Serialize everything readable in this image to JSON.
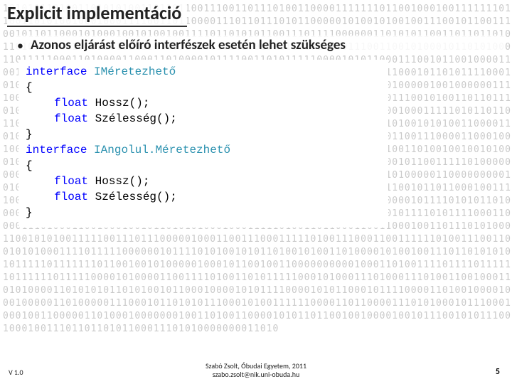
{
  "title": "Explicit implementáció",
  "bullet": "Azonos eljárást előíró interfészek esetén lehet szükséges",
  "code": {
    "l1_kw": "interface",
    "l1_type": "IMéretezhető",
    "l2": "{",
    "l3_kw": "float",
    "l3_rest": " Hossz();",
    "l4_kw": "float",
    "l4_rest": " Szélesség();",
    "l5": "}",
    "l6_kw": "interface",
    "l6_type": "IAngolul.Méretezhető",
    "l7": "{",
    "l8_kw": "float",
    "l8_rest": " Hossz();",
    "l9_kw": "float",
    "l9_rest": " Szélesség();",
    "l10": "}"
  },
  "footer": {
    "version": "V 1.0",
    "line1": "Szabó Zsolt, Óbudai Egyetem, 2011",
    "line2": "szabo.zsolt@nik.uni-obuda.hu",
    "page": "5"
  },
  "bg": "10101111010011010101001101101100111001101110100110000111111101100100010011111110110011010100100010001111001101100001110110111010110000010100101001001110010110011100101101100010100010010100100111101101010110011101111000000110101011001101101101011010011100100001011110101001011011010100110111010100001110011001010001011010100011011111000110100001100011010000101111001101011111000010101100011100101100100001100100001011110100111101100001100001111100001010111100101010101100010110101111000101001101010110101010110100001110001100011010001101000001110000100000100100000011110000100010001110110001010100111101011010010110101010010101010111001010011011011101011001111100001010011110000100111001101000001000100110101000010001111101011011011011101110000100111110110011000111100000101000110000100110001010010101001100001101010111101011010100001110011101011011101010001101000101110100110011100001100010010001011111011010000001011001000000110001010111010001010110101001101001001001010001001110000011100001011010101001001000101010101101000001110000010110011111010000000000010000101011000010010101000011010101010110011101001001011010000011000000000101000010111110001000110001000010001010010100000001000000101111100101101100010011110000111010111010101000001101001000010011110001111000111100010000101111010101101000010101100011010101010110111010111110001001010001010111110000101111010111100011000011101000110010001001011010101000100011111010011011000110011000100110111010100011001010100111110011101110000010001100111000111110100111000110011111101001110011001010100011110111110000001011110101001010110100101001101000010100100111011010101010111110111111101100100101000001000101100100110000000000100011010011110111101111110111111011111000010100001100111101001101011111000101000111010001110100110010001101010000110101010110101001011000100001010111100001010110001011110000110100100001000100000110100000111000101101010111000101001111110000110110000111010100010111000100010011000001101000100000001001101001100001010110110010010000100101110010101110010001001110110110101100011101010000000011010"
}
